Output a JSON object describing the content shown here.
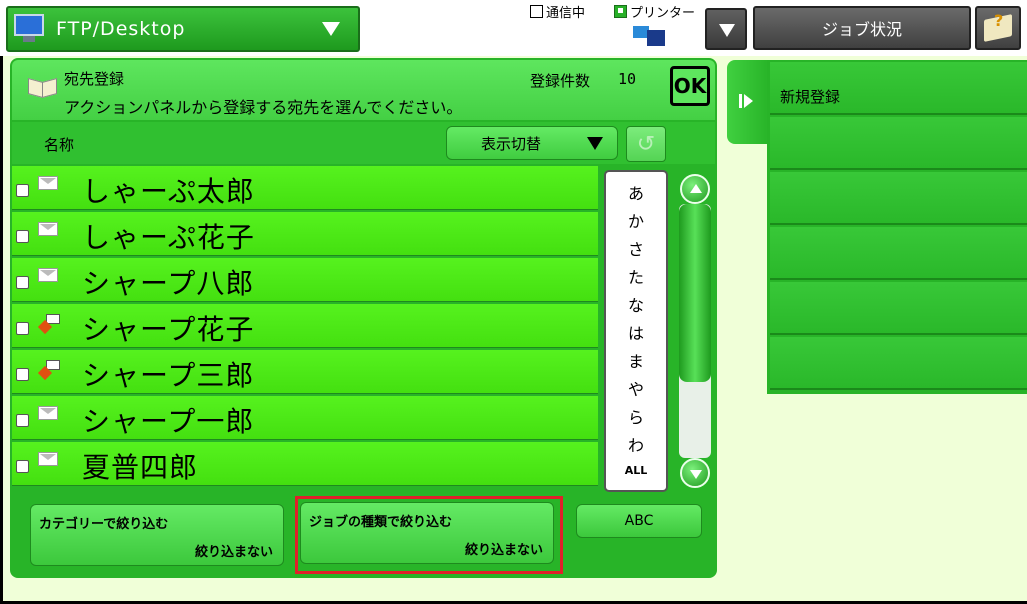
{
  "top": {
    "mode_label": "FTP/Desktop",
    "comm_label": "通信中",
    "printer_label": "プリンター",
    "job_status_label": "ジョブ状況"
  },
  "header": {
    "title": "宛先登録",
    "instruction": "アクションパネルから登録する宛先を選んでください。",
    "count_label": "登録件数",
    "count_value": "10",
    "ok_label": "OK"
  },
  "list": {
    "column_name": "名称",
    "view_toggle_label": "表示切替",
    "rows": [
      {
        "name": "しゃーぷ太郎",
        "icon": "mail-icon"
      },
      {
        "name": "しゃーぷ花子",
        "icon": "mail-icon"
      },
      {
        "name": "シャープ八郎",
        "icon": "mail-icon"
      },
      {
        "name": "シャープ花子",
        "icon": "ftp-icon"
      },
      {
        "name": "シャープ三郎",
        "icon": "ftp-icon"
      },
      {
        "name": "シャープ一郎",
        "icon": "mail-icon"
      },
      {
        "name": "夏普四郎",
        "icon": "mail-icon"
      }
    ]
  },
  "index": [
    "あ",
    "か",
    "さ",
    "た",
    "な",
    "は",
    "ま",
    "や",
    "ら",
    "わ",
    "ALL"
  ],
  "filters": {
    "category_title": "カテゴリーで絞り込む",
    "category_value": "絞り込まない",
    "job_title": "ジョブの種類で絞り込む",
    "job_value": "絞り込まない",
    "abc_label": "ABC"
  },
  "right_panel": {
    "items": [
      "新規登録",
      "",
      "",
      "",
      "",
      ""
    ]
  },
  "colors": {
    "accent_green": "#28b428",
    "row_green": "#56f21e",
    "highlight_red": "#e0202a"
  }
}
